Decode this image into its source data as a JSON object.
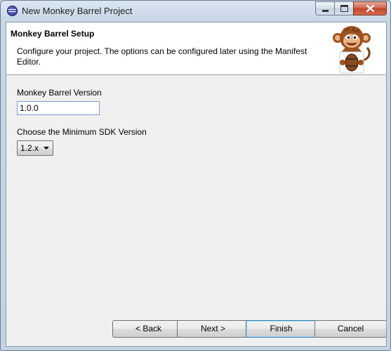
{
  "window": {
    "title": "New Monkey Barrel Project"
  },
  "icons": {
    "app": "eclipse-icon",
    "minimize": "minimize-icon",
    "maximize": "maximize-icon",
    "close": "close-icon",
    "mascot": "monkey-with-barrel-icon",
    "dropdown": "chevron-down-icon"
  },
  "banner": {
    "title": "Monkey Barrel Setup",
    "description": "Configure your project. The options can be configured later using the Manifest Editor."
  },
  "form": {
    "version_label": "Monkey Barrel Version",
    "version_value": "1.0.0",
    "sdk_label": "Choose the Minimum SDK Version",
    "sdk_selected": "1.2.x"
  },
  "buttons": {
    "back": "< Back",
    "next": "Next >",
    "finish": "Finish",
    "cancel": "Cancel"
  },
  "colors": {
    "accent": "#3c7fb1",
    "close_button": "#c0442b"
  }
}
